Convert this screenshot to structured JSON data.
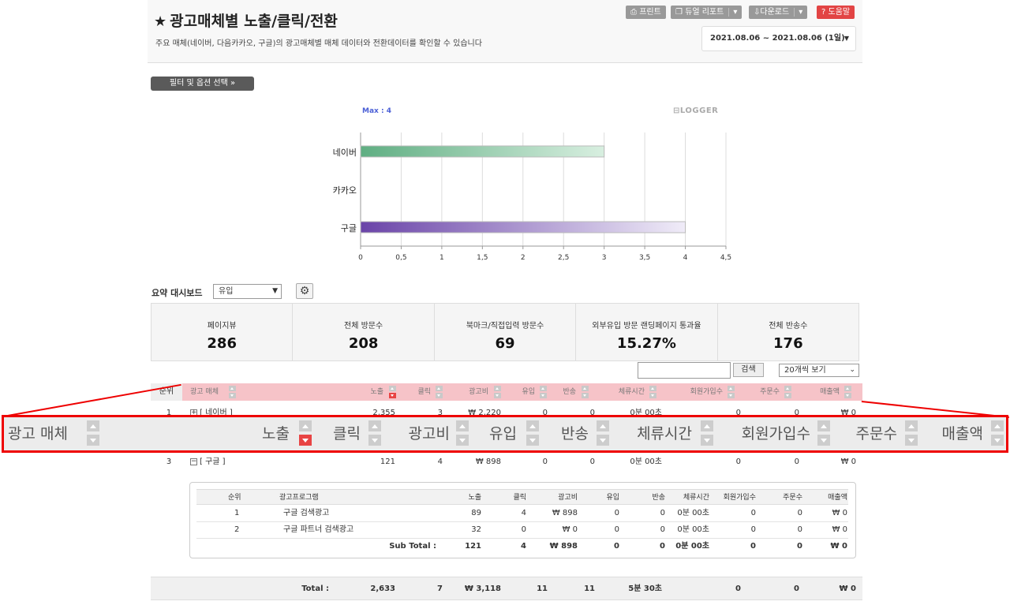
{
  "header": {
    "title": "광고매체별 노출/클릭/전환",
    "subtitle": "주요 매체(네이버, 다음카카오, 구글)의 광고매체별 매체 데이터와 전환데이터를 확인할 수 있습니다",
    "buttons": {
      "print": "프린트",
      "dual_report": "듀얼 리포트",
      "download": "다운로드",
      "help": "도움말"
    },
    "date_range": "2021.08.06 ~ 2021.08.06 (1일)"
  },
  "filter_button": "필터 및 옵션 선택",
  "chart_data": {
    "type": "bar",
    "orientation": "horizontal",
    "categories": [
      "네이버",
      "카카오",
      "구글"
    ],
    "values": [
      3,
      0,
      4
    ],
    "max_label": "Max : 4",
    "xlim": [
      0,
      4.5
    ],
    "xticks": [
      "0",
      "0,5",
      "1",
      "1,5",
      "2",
      "2,5",
      "3",
      "3,5",
      "4",
      "4,5"
    ],
    "colors": [
      "#5fae82",
      "#ffffff",
      "#6a44a8"
    ],
    "grid": true,
    "watermark": "LOGGER"
  },
  "summary": {
    "label": "요약 대시보드",
    "select_value": "유입",
    "cards": [
      {
        "label": "페이지뷰",
        "value": "286"
      },
      {
        "label": "전체 방문수",
        "value": "208"
      },
      {
        "label": "북마크/직접입력 방문수",
        "value": "69"
      },
      {
        "label": "외부유입 방문 랜딩페이지 통과율",
        "value": "15.27%"
      },
      {
        "label": "전체 반송수",
        "value": "176"
      }
    ]
  },
  "search": {
    "button": "검색",
    "per_page": "20개씩 보기"
  },
  "table": {
    "rank_header": "순위",
    "headers": [
      "광고 매체",
      "노출",
      "클릭",
      "광고비",
      "유입",
      "반송",
      "체류시간",
      "회원가입수",
      "주문수",
      "매출액"
    ],
    "rows": [
      {
        "rank": "1",
        "name": "[ 네이버 ]",
        "imp": "2,355",
        "clk": "3",
        "cost": "₩ 2,220",
        "in": "0",
        "bounce": "0",
        "stay": "0분 00초",
        "join": "0",
        "order": "0",
        "sales": "₩ 0"
      },
      {
        "rank": "3",
        "name": "[ 구글 ]",
        "imp": "121",
        "clk": "4",
        "cost": "₩ 898",
        "in": "0",
        "bounce": "0",
        "stay": "0분 00초",
        "join": "0",
        "order": "0",
        "sales": "₩ 0"
      }
    ],
    "sub": {
      "headers": [
        "순위",
        "광고프로그램",
        "노출",
        "클릭",
        "광고비",
        "유입",
        "반송",
        "체류시간",
        "회원가입수",
        "주문수",
        "매출액"
      ],
      "rows": [
        {
          "rank": "1",
          "name": "구글 검색광고",
          "imp": "89",
          "clk": "4",
          "cost": "₩ 898",
          "in": "0",
          "bounce": "0",
          "stay": "0분 00초",
          "join": "0",
          "order": "0",
          "sales": "₩ 0"
        },
        {
          "rank": "2",
          "name": "구글 파트너 검색광고",
          "imp": "32",
          "clk": "0",
          "cost": "₩ 0",
          "in": "0",
          "bounce": "0",
          "stay": "0분 00초",
          "join": "0",
          "order": "0",
          "sales": "₩ 0"
        }
      ],
      "subtotal": {
        "label": "Sub Total :",
        "imp": "121",
        "clk": "4",
        "cost": "₩ 898",
        "in": "0",
        "bounce": "0",
        "stay": "0분 00초",
        "join": "0",
        "order": "0",
        "sales": "₩ 0"
      }
    },
    "total": {
      "label": "Total :",
      "imp": "2,633",
      "clk": "7",
      "cost": "₩ 3,118",
      "in": "11",
      "bounce": "11",
      "stay": "5분 30초",
      "join": "0",
      "order": "0",
      "sales": "₩ 0"
    }
  }
}
